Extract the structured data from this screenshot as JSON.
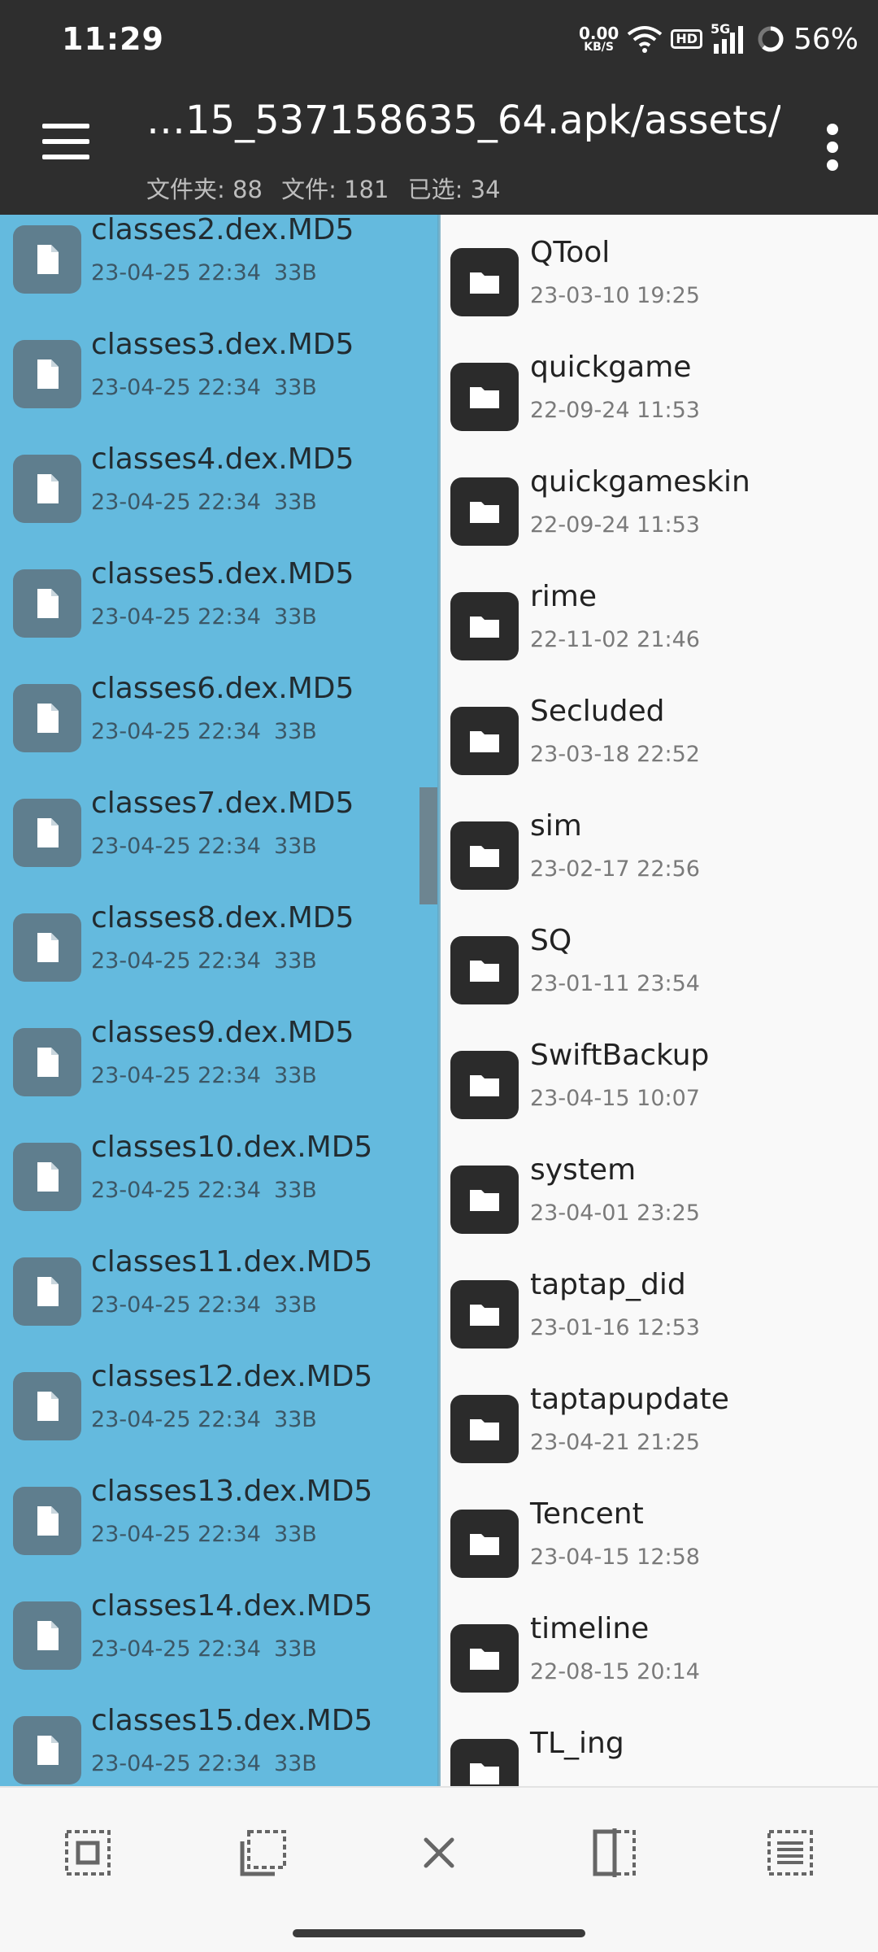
{
  "status_bar": {
    "time": "11:29",
    "net_speed_value": "0.00",
    "net_speed_unit": "KB/S",
    "hd_badge": "HD",
    "signal_label": "5G",
    "battery": "56%"
  },
  "app_bar": {
    "title": "…15_537158635_64.apk/assets/",
    "folders": "文件夹: 88",
    "files": "文件: 181",
    "selected": "已选: 34"
  },
  "left_pane": {
    "items": [
      {
        "name": "classes2.dex.MD5",
        "date": "23-04-25 22:34",
        "size": "33B"
      },
      {
        "name": "classes3.dex.MD5",
        "date": "23-04-25 22:34",
        "size": "33B"
      },
      {
        "name": "classes4.dex.MD5",
        "date": "23-04-25 22:34",
        "size": "33B"
      },
      {
        "name": "classes5.dex.MD5",
        "date": "23-04-25 22:34",
        "size": "33B"
      },
      {
        "name": "classes6.dex.MD5",
        "date": "23-04-25 22:34",
        "size": "33B"
      },
      {
        "name": "classes7.dex.MD5",
        "date": "23-04-25 22:34",
        "size": "33B"
      },
      {
        "name": "classes8.dex.MD5",
        "date": "23-04-25 22:34",
        "size": "33B"
      },
      {
        "name": "classes9.dex.MD5",
        "date": "23-04-25 22:34",
        "size": "33B"
      },
      {
        "name": "classes10.dex.MD5",
        "date": "23-04-25 22:34",
        "size": "33B"
      },
      {
        "name": "classes11.dex.MD5",
        "date": "23-04-25 22:34",
        "size": "33B"
      },
      {
        "name": "classes12.dex.MD5",
        "date": "23-04-25 22:34",
        "size": "33B"
      },
      {
        "name": "classes13.dex.MD5",
        "date": "23-04-25 22:34",
        "size": "33B"
      },
      {
        "name": "classes14.dex.MD5",
        "date": "23-04-25 22:34",
        "size": "33B"
      },
      {
        "name": "classes15.dex.MD5",
        "date": "23-04-25 22:34",
        "size": "33B"
      }
    ]
  },
  "right_pane": {
    "items": [
      {
        "name": "QTool",
        "date": "23-03-10 19:25"
      },
      {
        "name": "quickgame",
        "date": "22-09-24 11:53"
      },
      {
        "name": "quickgameskin",
        "date": "22-09-24 11:53"
      },
      {
        "name": "rime",
        "date": "22-11-02 21:46"
      },
      {
        "name": "Secluded",
        "date": "23-03-18 22:52"
      },
      {
        "name": "sim",
        "date": "23-02-17 22:56"
      },
      {
        "name": "SQ",
        "date": "23-01-11 23:54"
      },
      {
        "name": "SwiftBackup",
        "date": "23-04-15 10:07"
      },
      {
        "name": "system",
        "date": "23-04-01 23:25"
      },
      {
        "name": "taptap_did",
        "date": "23-01-16 12:53"
      },
      {
        "name": "taptapupdate",
        "date": "23-04-21 21:25"
      },
      {
        "name": "Tencent",
        "date": "23-04-15 12:58"
      },
      {
        "name": "timeline",
        "date": "22-08-15 20:14"
      },
      {
        "name": "TL_ing",
        "date": ""
      }
    ]
  },
  "toolbar": {
    "icons": [
      "select-all-icon",
      "select-range-icon",
      "clear-selection-icon",
      "invert-selection-icon",
      "select-list-icon"
    ]
  },
  "colors": {
    "selected_bg": "#64bade",
    "appbar_bg": "#2e2e2e",
    "folder_icon_bg": "#2b2b2b",
    "file_icon_bg": "#5f7e8e"
  }
}
